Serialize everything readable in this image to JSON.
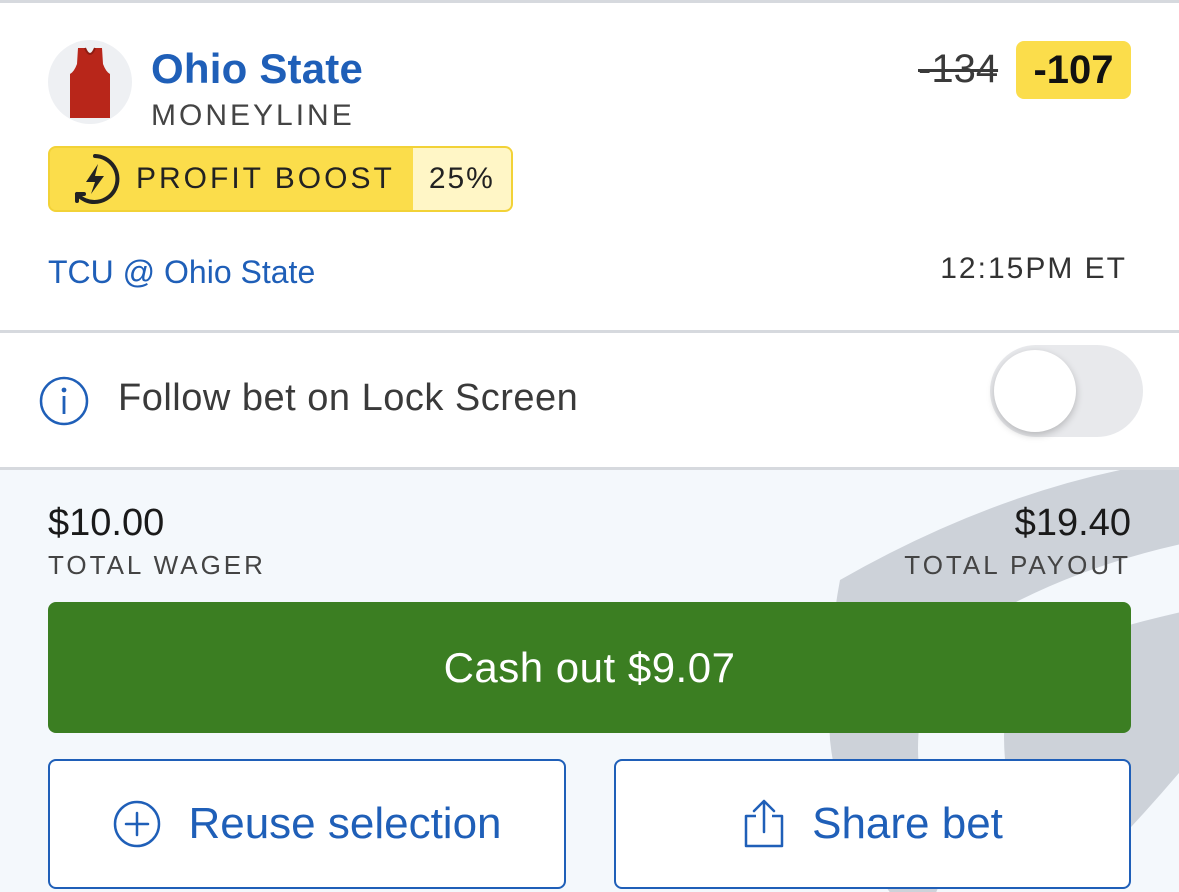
{
  "selection": {
    "team": "Ohio State",
    "market": "MONEYLINE",
    "boost_label": "PROFIT BOOST",
    "boost_percent": "25%",
    "odds_original": "-134",
    "odds_boosted": "-107",
    "event": "TCU @ Ohio State",
    "time": "12:15PM ET",
    "avatar_icon": "jersey-icon",
    "jersey_color": "#b8261a"
  },
  "lock_screen": {
    "label": "Follow bet on Lock Screen",
    "toggle_on": false
  },
  "summary": {
    "wager_amount": "$10.00",
    "wager_label": "TOTAL WAGER",
    "payout_amount": "$19.40",
    "payout_label": "TOTAL PAYOUT"
  },
  "actions": {
    "cashout_label": "Cash out $9.07",
    "reuse_label": "Reuse selection",
    "share_label": "Share bet"
  },
  "colors": {
    "brand_blue": "#1f5fb8",
    "boost_yellow": "#fbdd4b",
    "cashout_green": "#3b7e22"
  }
}
